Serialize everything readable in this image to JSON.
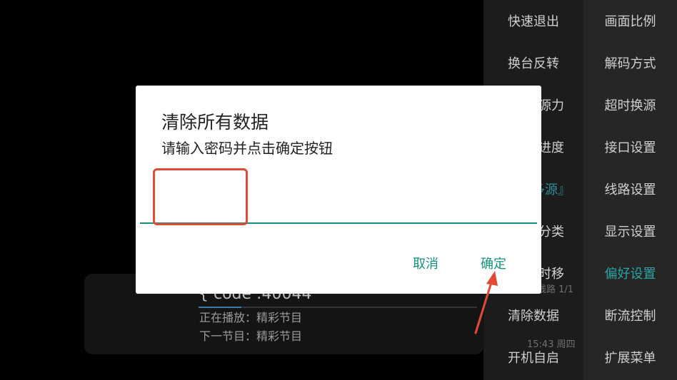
{
  "menu": {
    "left_column": [
      "快速退出",
      "换台反转",
      "源力",
      "进度",
      "多源』",
      "分类",
      "时移",
      "清除数据",
      "开机自启"
    ],
    "right_column": [
      "画面比例",
      "解码方式",
      "超时换源",
      "接口设置",
      "线路设置",
      "显示设置",
      "偏好设置",
      "断流控制",
      "扩展菜单"
    ],
    "active_item": "偏好设置"
  },
  "player": {
    "code": "{ code :40044",
    "now_playing": "正在播放：精彩节目",
    "next_program": "下一节目：精彩节目",
    "route": "线路 1/1",
    "clock": "15:43 周四"
  },
  "dialog": {
    "title": "清除所有数据",
    "message": "请输入密码并点击确定按钮",
    "password_value": "",
    "cancel_label": "取消",
    "confirm_label": "确定"
  },
  "colors": {
    "accent": "#14907f",
    "active_menu": "#2aa5a5",
    "annotation": "#e04b35"
  }
}
